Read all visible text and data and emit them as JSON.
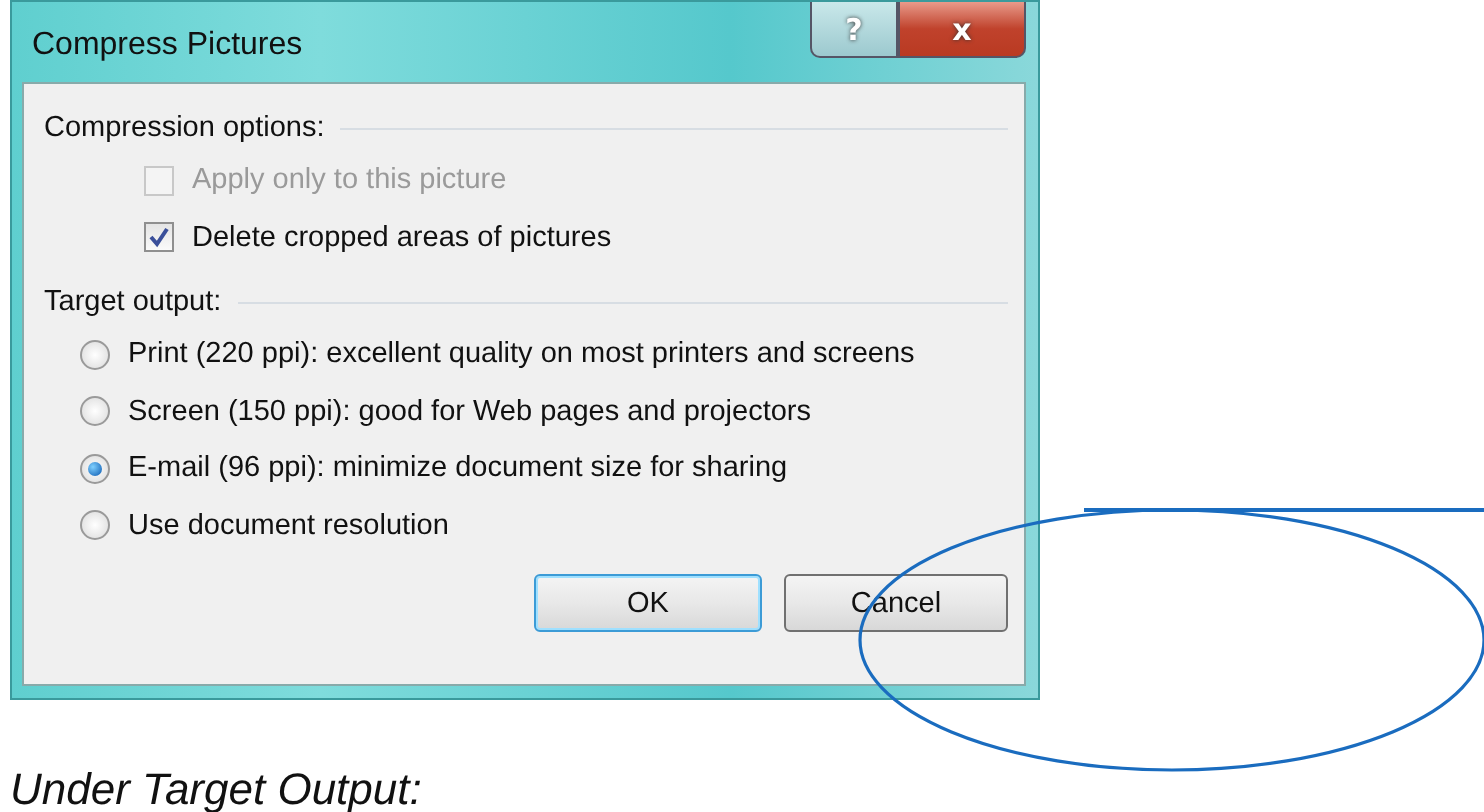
{
  "window": {
    "title": "Compress Pictures",
    "help_button": "?",
    "close_button": "x"
  },
  "compression_options": {
    "heading": "Compression options:",
    "items": [
      {
        "label": "Apply only to this picture",
        "checked": false,
        "disabled": true
      },
      {
        "label": "Delete cropped areas of pictures",
        "checked": true,
        "disabled": false
      }
    ]
  },
  "target_output": {
    "heading": "Target output:",
    "options": [
      {
        "label": "Print (220 ppi): excellent quality on most printers and screens",
        "selected": false
      },
      {
        "label": "Screen (150 ppi): good for Web pages and projectors",
        "selected": false
      },
      {
        "label": "E-mail (96 ppi): minimize document size for sharing",
        "selected": true
      },
      {
        "label": "Use document resolution",
        "selected": false
      }
    ]
  },
  "buttons": [
    {
      "label": "OK",
      "default": true
    },
    {
      "label": "Cancel",
      "default": false
    }
  ],
  "caption": "Under Target Output:"
}
